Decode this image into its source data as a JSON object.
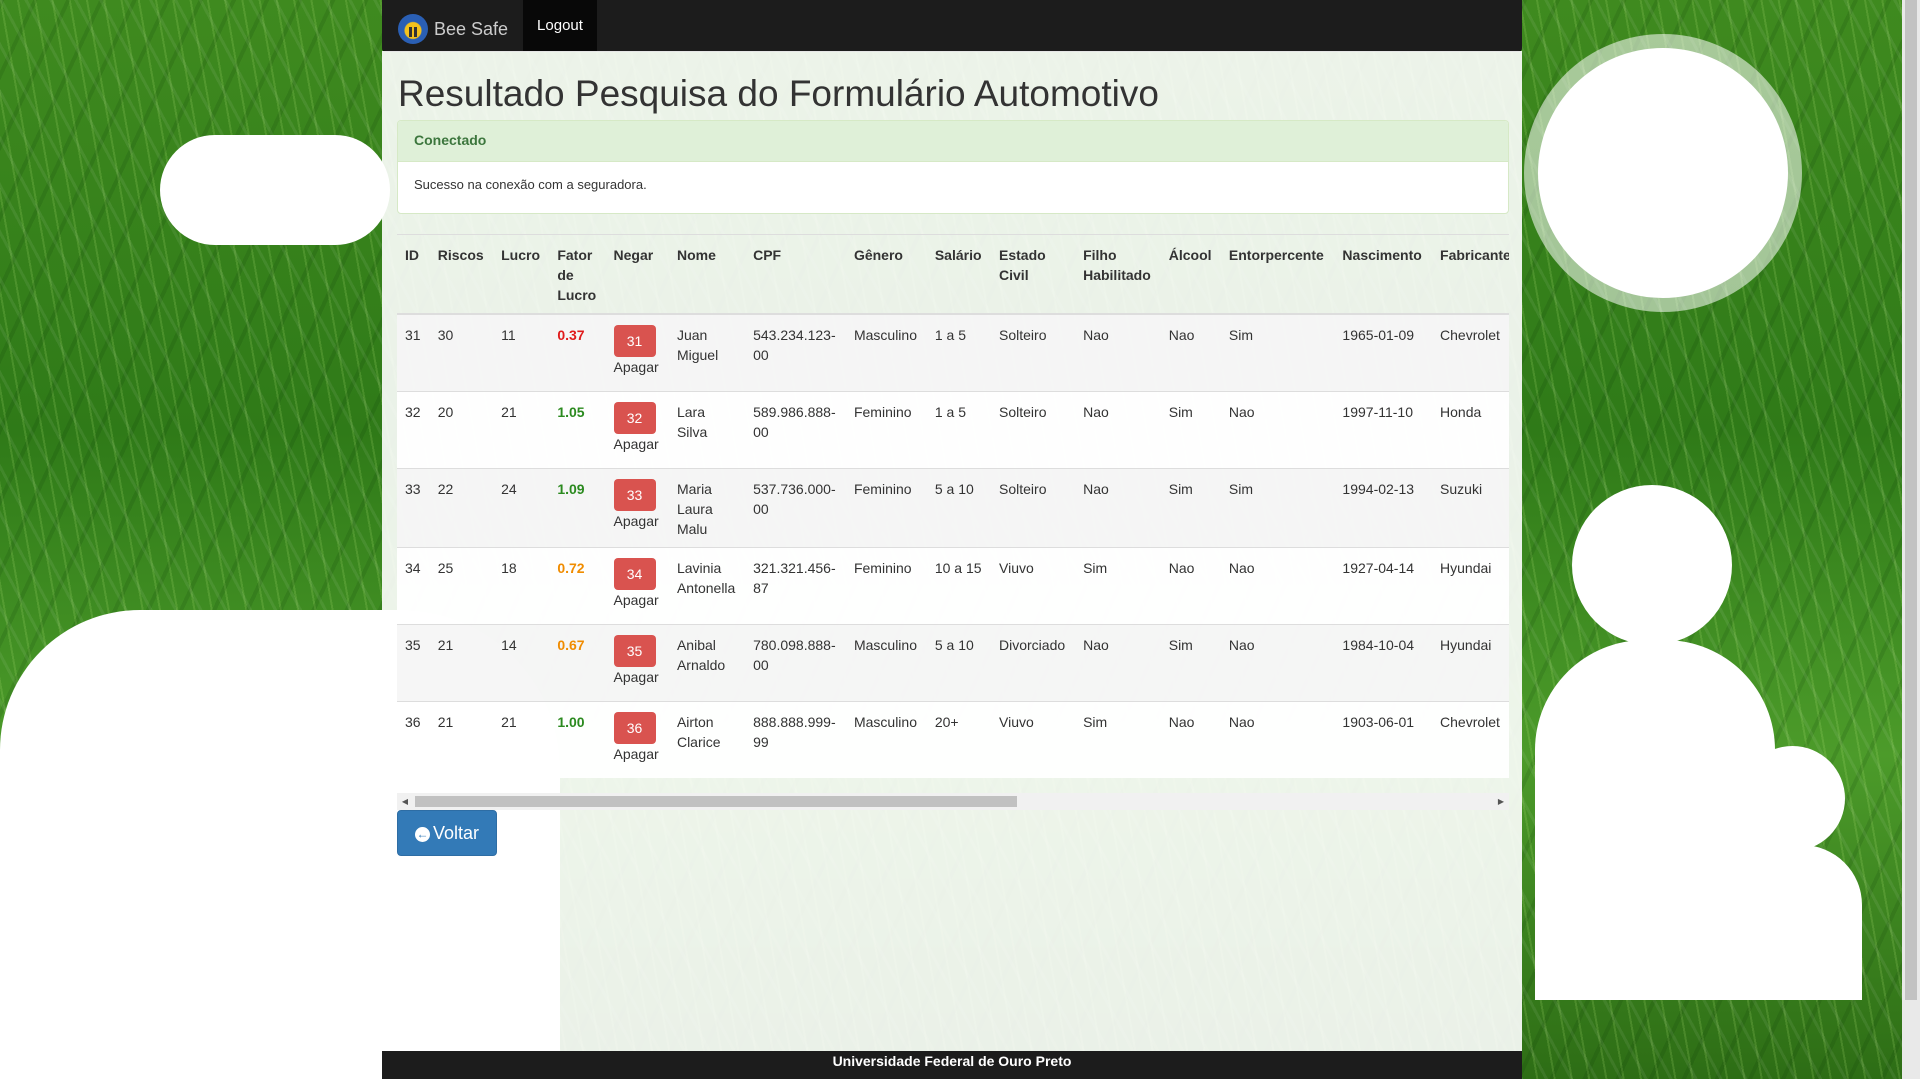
{
  "navbar": {
    "brand": "Bee Safe",
    "logout": "Logout"
  },
  "page": {
    "title": "Resultado Pesquisa do Formulário Automotivo"
  },
  "alert": {
    "heading": "Conectado",
    "message": "Sucesso na conexão com a seguradora."
  },
  "table": {
    "headers": [
      "ID",
      "Riscos",
      "Lucro",
      "Fator de Lucro",
      "Negar",
      "Nome",
      "CPF",
      "Gênero",
      "Salário",
      "Estado Civil",
      "Filho Habilitado",
      "Álcool",
      "Entorpercente",
      "Nascimento",
      "Fabricante"
    ],
    "negar_label": "Apagar",
    "rows": [
      {
        "id": "31",
        "riscos": "30",
        "lucro": "11",
        "fator": "0.37",
        "fator_color": "#e01b1b",
        "negar": "31",
        "nome": "Juan Miguel",
        "cpf": "543.234.123-00",
        "genero": "Masculino",
        "salario": "1 a 5",
        "estado_civil": "Solteiro",
        "filho": "Nao",
        "alcool": "Nao",
        "entorpercente": "Sim",
        "nascimento": "1965-01-09",
        "fabricante": "Chevrolet"
      },
      {
        "id": "32",
        "riscos": "20",
        "lucro": "21",
        "fator": "1.05",
        "fator_color": "#2b8a1f",
        "negar": "32",
        "nome": "Lara Silva",
        "cpf": "589.986.888-00",
        "genero": "Feminino",
        "salario": "1 a 5",
        "estado_civil": "Solteiro",
        "filho": "Nao",
        "alcool": "Sim",
        "entorpercente": "Nao",
        "nascimento": "1997-11-10",
        "fabricante": "Honda"
      },
      {
        "id": "33",
        "riscos": "22",
        "lucro": "24",
        "fator": "1.09",
        "fator_color": "#2b8a1f",
        "negar": "33",
        "nome": "Maria Laura Malu",
        "cpf": "537.736.000-00",
        "genero": "Feminino",
        "salario": "5 a 10",
        "estado_civil": "Solteiro",
        "filho": "Nao",
        "alcool": "Sim",
        "entorpercente": "Sim",
        "nascimento": "1994-02-13",
        "fabricante": "Suzuki"
      },
      {
        "id": "34",
        "riscos": "25",
        "lucro": "18",
        "fator": "0.72",
        "fator_color": "#f08c00",
        "negar": "34",
        "nome": "Lavinia Antonella",
        "cpf": "321.321.456-87",
        "genero": "Feminino",
        "salario": "10 a 15",
        "estado_civil": "Viuvo",
        "filho": "Sim",
        "alcool": "Nao",
        "entorpercente": "Nao",
        "nascimento": "1927-04-14",
        "fabricante": "Hyundai"
      },
      {
        "id": "35",
        "riscos": "21",
        "lucro": "14",
        "fator": "0.67",
        "fator_color": "#f08c00",
        "negar": "35",
        "nome": "Anibal Arnaldo",
        "cpf": "780.098.888-00",
        "genero": "Masculino",
        "salario": "5 a 10",
        "estado_civil": "Divorciado",
        "filho": "Nao",
        "alcool": "Sim",
        "entorpercente": "Nao",
        "nascimento": "1984-10-04",
        "fabricante": "Hyundai"
      },
      {
        "id": "36",
        "riscos": "21",
        "lucro": "21",
        "fator": "1.00",
        "fator_color": "#2b8a1f",
        "negar": "36",
        "nome": "Airton Clarice",
        "cpf": "888.888.999-99",
        "genero": "Masculino",
        "salario": "20+",
        "estado_civil": "Viuvo",
        "filho": "Sim",
        "alcool": "Nao",
        "entorpercente": "Nao",
        "nascimento": "1903-06-01",
        "fabricante": "Chevrolet"
      }
    ]
  },
  "buttons": {
    "voltar": "Voltar"
  },
  "footer": {
    "line1": "Universidade Federal de Ouro Preto"
  },
  "colors": {
    "danger": "#d9534f",
    "primary": "#337ab7",
    "success_bg": "#dff0d8"
  }
}
